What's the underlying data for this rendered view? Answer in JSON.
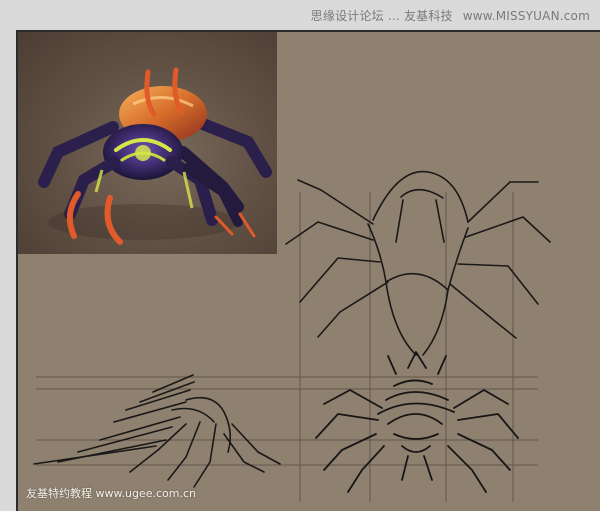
{
  "watermarks": {
    "top": "思缘设计论坛 ... 友基科技",
    "top_site": "www.MISSYUAN.com",
    "bottom": "友基特约教程 www.ugee.com.cn"
  },
  "colors": {
    "canvas": "#8f8170",
    "reference_bg": "#5f4f43",
    "sketch_line": "#141414",
    "guide_line": "#5c5148",
    "spider_body": "#3b2a6a",
    "spider_glow": "#d5e64b",
    "spider_accent": "#e05a2a"
  },
  "icons": {
    "reference_art": "spider-illustration",
    "sketches": "pencil-sketch-lines"
  }
}
